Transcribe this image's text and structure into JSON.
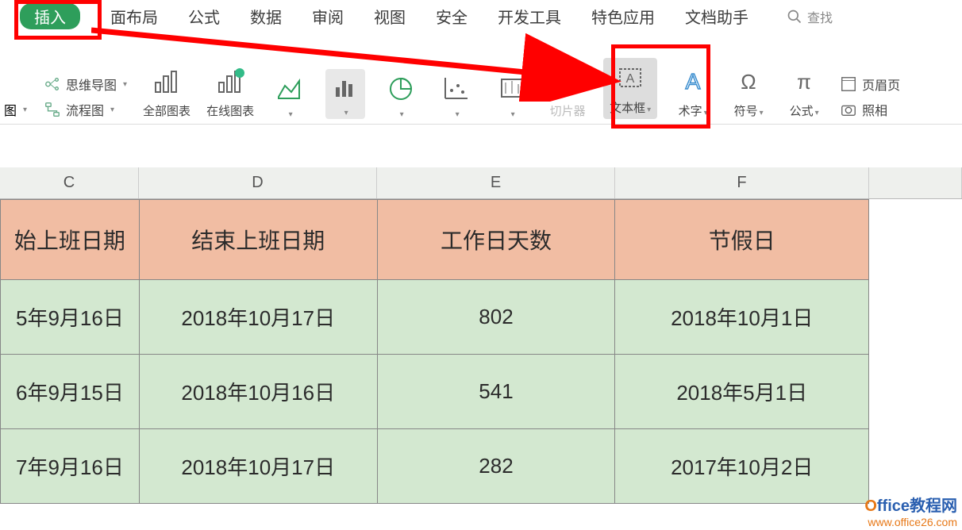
{
  "tabs": {
    "insert": "插入",
    "layout": "面布局",
    "formula": "公式",
    "data": "数据",
    "review": "审阅",
    "view": "视图",
    "security": "安全",
    "devtools": "开发工具",
    "special": "特色应用",
    "dochelp": "文档助手",
    "search": "查找"
  },
  "tools": {
    "mindmap": "思维导图",
    "flowchart": "流程图",
    "allcharts": "全部图表",
    "onlinechart": "在线图表",
    "slicer": "切片器",
    "textbox": "文本框",
    "wordart": "术字",
    "symbol": "符号",
    "equation": "公式",
    "headerfooter": "页眉页",
    "camera": "照相"
  },
  "dropdown_labels": {
    "chart_button": "图"
  },
  "columns": {
    "C": "C",
    "D": "D",
    "E": "E",
    "F": "F"
  },
  "headers": {
    "C": "始上班日期",
    "D": "结束上班日期",
    "E": "工作日天数",
    "F": "节假日"
  },
  "rows": [
    {
      "C": "5年9月16日",
      "D": "2018年10月17日",
      "E": "802",
      "F": "2018年10月1日"
    },
    {
      "C": "6年9月15日",
      "D": "2018年10月16日",
      "E": "541",
      "F": "2018年5月1日"
    },
    {
      "C": "7年9月16日",
      "D": "2018年10月17日",
      "E": "282",
      "F": "2017年10月2日"
    }
  ],
  "watermark": {
    "line1a": "O",
    "line1b": "ffice教程网",
    "line2": "www.office26.com"
  }
}
